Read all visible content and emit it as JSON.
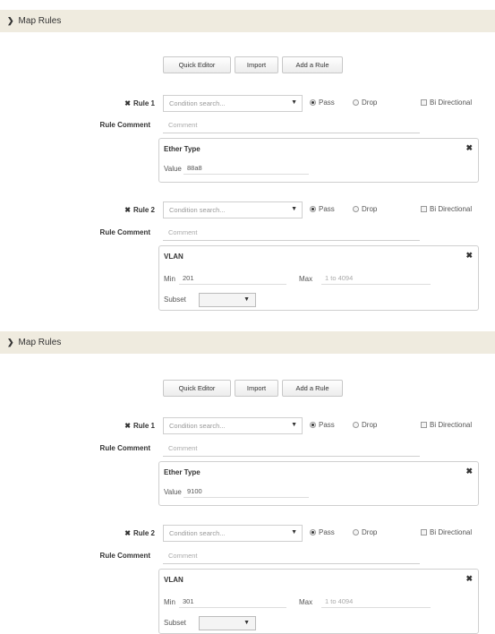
{
  "sections": [
    {
      "header": {
        "title": "Map Rules"
      },
      "toolbar": {
        "quick_editor": "Quick Editor",
        "import": "Import",
        "add_rule": "Add a Rule"
      },
      "rules": [
        {
          "label": "Rule 1",
          "condition_placeholder": "Condition search...",
          "options": {
            "pass": "Pass",
            "drop": "Drop",
            "bidirectional": "Bi Directional",
            "selected": "Pass"
          },
          "comment_label": "Rule Comment",
          "comment_placeholder": "Comment",
          "condition": {
            "title": "Ether Type",
            "value_label": "Value",
            "value": "88a8"
          }
        },
        {
          "label": "Rule 2",
          "condition_placeholder": "Condition search...",
          "options": {
            "pass": "Pass",
            "drop": "Drop",
            "bidirectional": "Bi Directional",
            "selected": "Pass"
          },
          "comment_label": "Rule Comment",
          "comment_placeholder": "Comment",
          "condition": {
            "title": "VLAN",
            "min_label": "Min",
            "min": "201",
            "max_label": "Max",
            "max_placeholder": "1 to 4094",
            "subset_label": "Subset"
          }
        }
      ]
    },
    {
      "header": {
        "title": "Map Rules"
      },
      "toolbar": {
        "quick_editor": "Quick Editor",
        "import": "Import",
        "add_rule": "Add a Rule"
      },
      "rules": [
        {
          "label": "Rule 1",
          "condition_placeholder": "Condition search...",
          "options": {
            "pass": "Pass",
            "drop": "Drop",
            "bidirectional": "Bi Directional",
            "selected": "Pass"
          },
          "comment_label": "Rule Comment",
          "comment_placeholder": "Comment",
          "condition": {
            "title": "Ether Type",
            "value_label": "Value",
            "value": "9100"
          }
        },
        {
          "label": "Rule 2",
          "condition_placeholder": "Condition search...",
          "options": {
            "pass": "Pass",
            "drop": "Drop",
            "bidirectional": "Bi Directional",
            "selected": "Pass"
          },
          "comment_label": "Rule Comment",
          "comment_placeholder": "Comment",
          "condition": {
            "title": "VLAN",
            "min_label": "Min",
            "min": "301",
            "max_label": "Max",
            "max_placeholder": "1 to 4094",
            "subset_label": "Subset"
          }
        }
      ]
    }
  ]
}
